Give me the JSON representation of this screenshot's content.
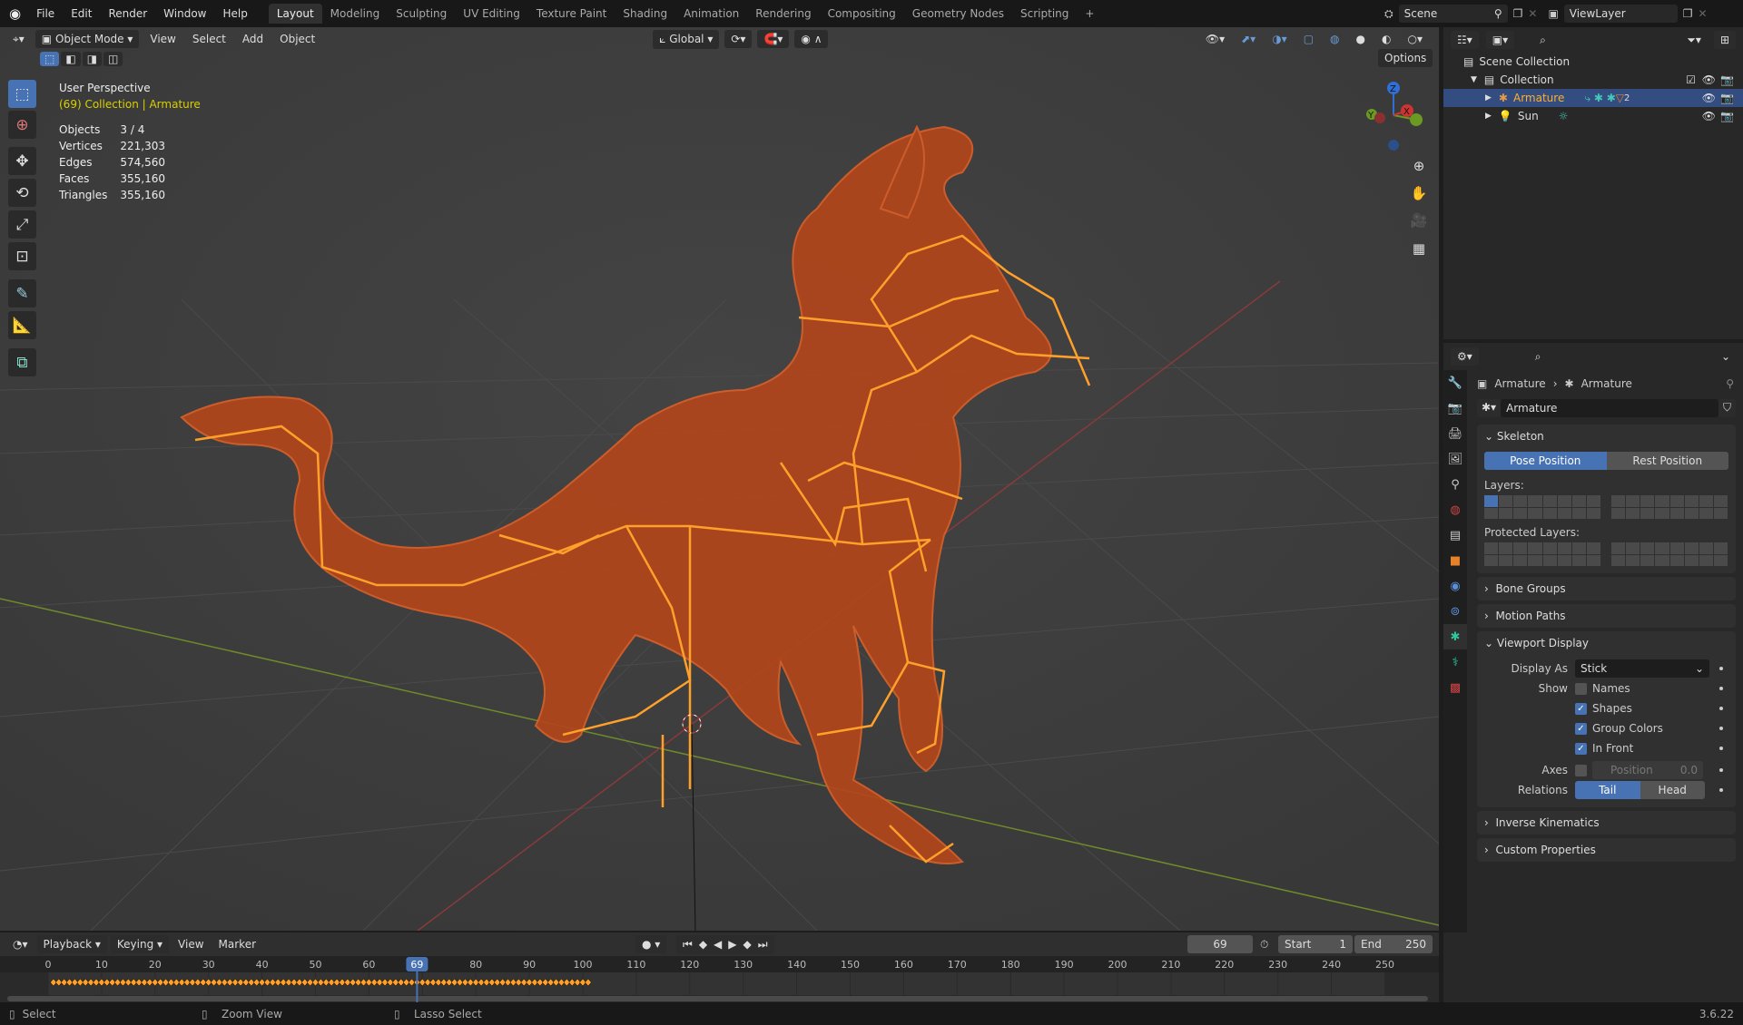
{
  "topbar": {
    "menus": [
      "File",
      "Edit",
      "Render",
      "Window",
      "Help"
    ],
    "workspaces": [
      "Layout",
      "Modeling",
      "Sculpting",
      "UV Editing",
      "Texture Paint",
      "Shading",
      "Animation",
      "Rendering",
      "Compositing",
      "Geometry Nodes",
      "Scripting"
    ],
    "add_workspace": "+",
    "scene": "Scene",
    "view_layer": "ViewLayer"
  },
  "viewport": {
    "mode": "Object Mode",
    "menus": [
      "View",
      "Select",
      "Add",
      "Object"
    ],
    "orientation": "Global",
    "options": "Options",
    "view_name": "User Perspective",
    "context": "(69) Collection | Armature",
    "stats": [
      {
        "label": "Objects",
        "value": "3 / 4"
      },
      {
        "label": "Vertices",
        "value": "221,303"
      },
      {
        "label": "Edges",
        "value": "574,560"
      },
      {
        "label": "Faces",
        "value": "355,160"
      },
      {
        "label": "Triangles",
        "value": "355,160"
      }
    ],
    "gizmo": {
      "x": "X",
      "y": "Y",
      "z": "Z"
    }
  },
  "outliner": {
    "scene_collection": "Scene Collection",
    "collection": "Collection",
    "items": [
      {
        "name": "Armature",
        "badge": "2"
      },
      {
        "name": "Sun"
      }
    ]
  },
  "properties": {
    "breadcrumb": [
      "Armature",
      "Armature"
    ],
    "data_name": "Armature",
    "skeleton": {
      "title": "Skeleton",
      "pose": "Pose Position",
      "rest": "Rest Position",
      "layers": "Layers:",
      "protected": "Protected Layers:"
    },
    "collapsed": [
      "Bone Groups",
      "Motion Paths"
    ],
    "viewport_display": {
      "title": "Viewport Display",
      "display_as_label": "Display As",
      "display_as": "Stick",
      "show_label": "Show",
      "checks": [
        {
          "label": "Names",
          "checked": false
        },
        {
          "label": "Shapes",
          "checked": true
        },
        {
          "label": "Group Colors",
          "checked": true
        },
        {
          "label": "In Front",
          "checked": true
        }
      ],
      "axes_label": "Axes",
      "position_label": "Position",
      "position_value": "0.0",
      "relations_label": "Relations",
      "tail": "Tail",
      "head": "Head"
    },
    "collapsed2": [
      "Inverse Kinematics",
      "Custom Properties"
    ]
  },
  "timeline": {
    "menus": [
      "Playback",
      "Keying",
      "View",
      "Marker"
    ],
    "current": "69",
    "start_label": "Start",
    "start": "1",
    "end_label": "End",
    "end": "250",
    "ticks": [
      0,
      10,
      20,
      30,
      40,
      50,
      60,
      80,
      90,
      100,
      110,
      120,
      130,
      140,
      150,
      160,
      170,
      180,
      190,
      200,
      210,
      220,
      230,
      240,
      250
    ],
    "current_frame": 69,
    "keyframe_range": [
      1,
      101
    ]
  },
  "status": {
    "select": "Select",
    "zoom": "Zoom View",
    "lasso": "Lasso Select",
    "version": "3.6.22"
  },
  "colors": {
    "accent": "#4772b3",
    "bone": "#ffa02a",
    "mesh": "#c8501e"
  }
}
